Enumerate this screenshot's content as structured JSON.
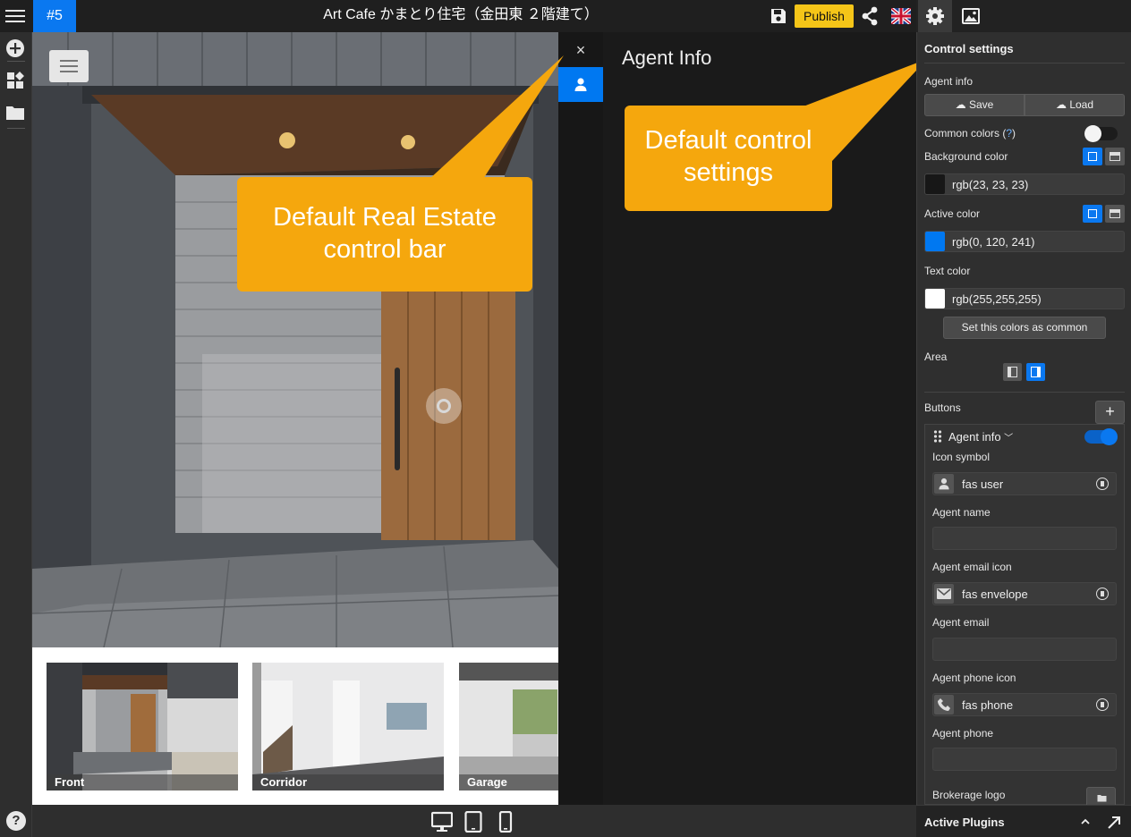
{
  "topbar": {
    "tab_number": "#5",
    "title": "Art Cafe かまとり住宅（金田東 ２階建て）",
    "publish_label": "Publish",
    "icons": [
      "menu-icon",
      "save-icon",
      "share-icon",
      "uk-flag-icon"
    ]
  },
  "leftbar": {
    "icons": [
      "plus-circle-icon",
      "widgets-icon",
      "folder-icon",
      "help-icon"
    ],
    "help_symbol": "?"
  },
  "viewer": {
    "close_symbol": "×",
    "agent_panel_title": "Agent Info"
  },
  "thumbnails": [
    {
      "label": "Front"
    },
    {
      "label": "Corridor"
    },
    {
      "label": "Garage"
    }
  ],
  "callouts": {
    "control_bar_line1": "Default Real Estate",
    "control_bar_line2": "control bar",
    "settings_line1": "Default control",
    "settings_line2": "settings"
  },
  "bottombar": {
    "icons": [
      "desktop-icon",
      "tablet-icon",
      "mobile-icon"
    ]
  },
  "right_panel": {
    "tabs": [
      "gear-icon",
      "image-icon"
    ],
    "heading": "Control settings",
    "agent_info_label": "Agent info",
    "save_label": "Save",
    "load_label": "Load",
    "common_colors_label": "Common colors (",
    "common_colors_link": "?",
    "common_colors_close": ")",
    "common_colors_toggle": false,
    "background_color_label": "Background color",
    "background_color_value": "rgb(23, 23, 23)",
    "background_swatch": "#171717",
    "active_color_label": "Active color",
    "active_color_value": "rgb(0, 120, 241)",
    "active_swatch": "#0078f1",
    "text_color_label": "Text color",
    "text_color_value": "rgb(255,255,255)",
    "text_swatch": "#ffffff",
    "set_common_label": "Set this colors as common",
    "area_label": "Area",
    "buttons_label": "Buttons",
    "add_symbol": "+",
    "button_item": {
      "name": "Agent info",
      "enabled": true,
      "icon_symbol_label": "Icon symbol",
      "icon_symbol_value": "fas user",
      "agent_name_label": "Agent name",
      "agent_name_value": "",
      "agent_email_icon_label": "Agent email icon",
      "agent_email_icon_value": "fas envelope",
      "agent_email_label": "Agent email",
      "agent_email_value": "",
      "agent_phone_icon_label": "Agent phone icon",
      "agent_phone_icon_value": "fas phone",
      "agent_phone_label": "Agent phone",
      "agent_phone_value": "",
      "brokerage_logo_label": "Brokerage logo"
    },
    "active_plugins_label": "Active Plugins"
  },
  "colors": {
    "accent_blue": "#0a78f0",
    "publish_yellow": "#f5c518",
    "callout_orange": "#f5a70d"
  }
}
